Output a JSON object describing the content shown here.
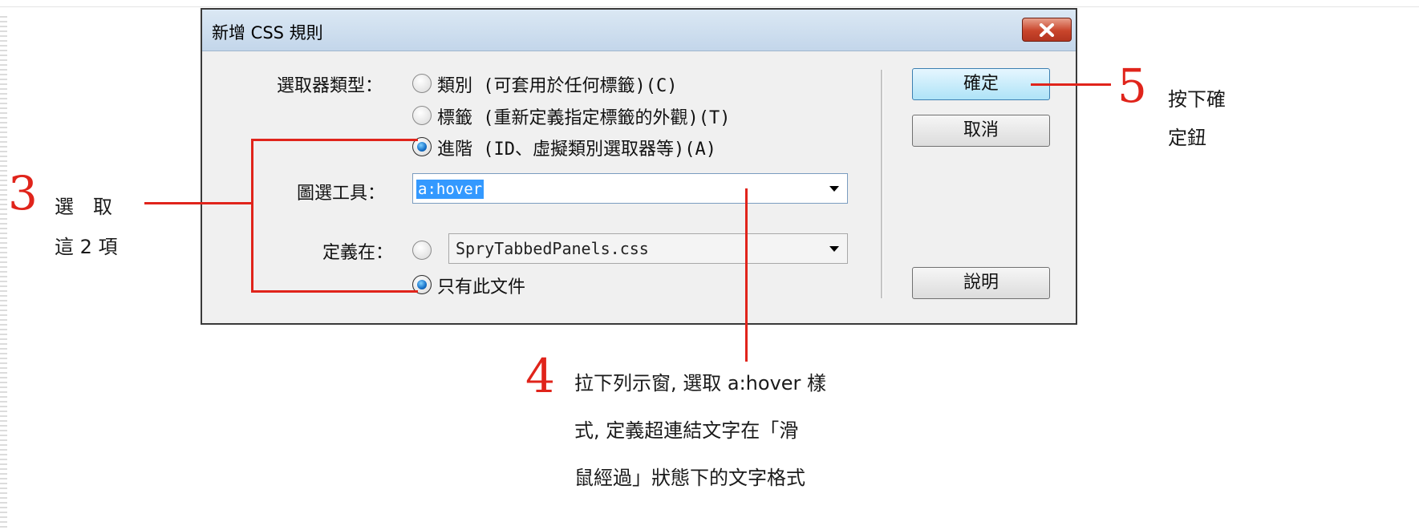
{
  "dialog": {
    "title": "新增 CSS 規則",
    "selector_type_label": "選取器類型：",
    "options": [
      {
        "main": "類別",
        "desc": " (可套用於任何標籤)(C)",
        "checked": false
      },
      {
        "main": "標籤",
        "desc": " (重新定義指定標籤的外觀)(T)",
        "checked": false
      },
      {
        "main": "進階",
        "desc": " (ID、虛擬類別選取器等)(A)",
        "checked": true
      }
    ],
    "selector_label": "圖選工具：",
    "selector_value": "a:hover",
    "define_in_label": "定義在：",
    "stylesheet_value": "SpryTabbedPanels.css",
    "this_document_label": "只有此文件",
    "ok_label": "確定",
    "cancel_label": "取消",
    "help_label": "說明"
  },
  "annotations": {
    "step3": {
      "number": "3",
      "line1": "選　取",
      "line2": "這 2 項"
    },
    "step4": {
      "number": "4",
      "line1": "拉下列示窗, 選取 a:hover 樣",
      "line2": "式, 定義超連結文字在「滑",
      "line3": "鼠經過」狀態下的文字格式"
    },
    "step5": {
      "number": "5",
      "line1": "按下確",
      "line2": "定鈕"
    }
  },
  "colors": {
    "annotation": "#e0241b",
    "title_bar": "#c3d6ea",
    "primary_button": "#aee3f7"
  }
}
